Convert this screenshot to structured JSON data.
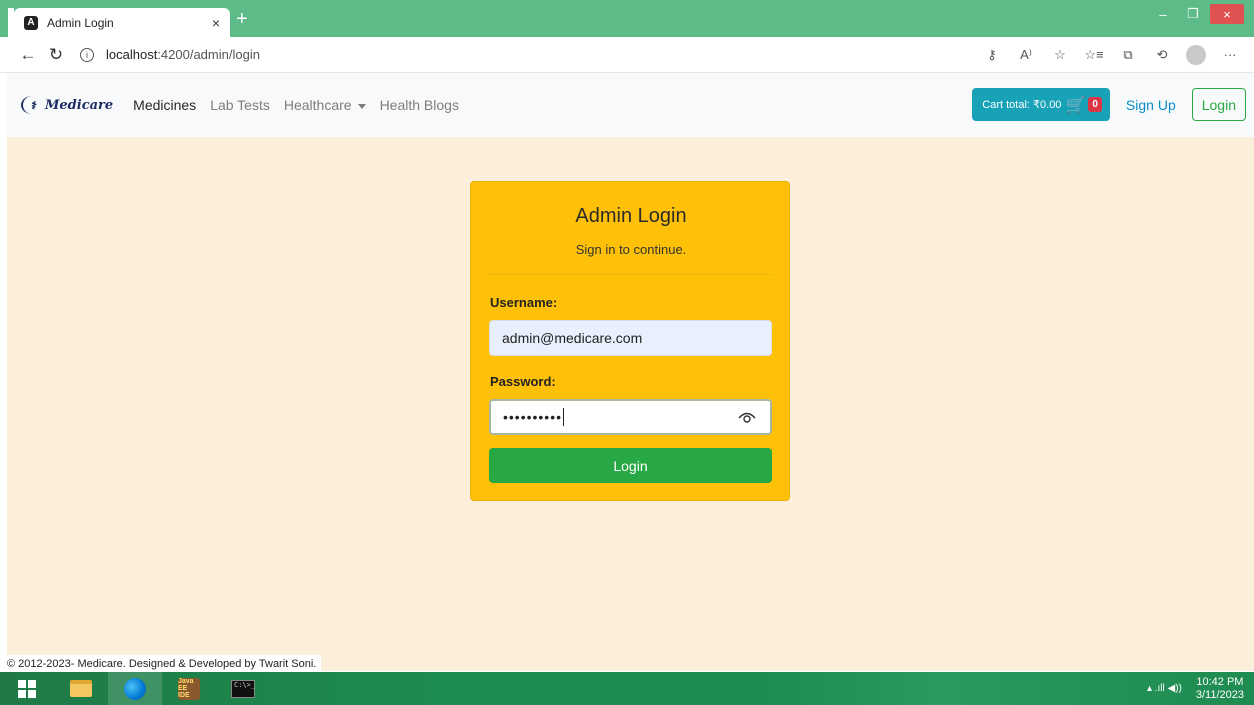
{
  "browser": {
    "tab_title": "Admin Login",
    "tab_close": "×",
    "new_tab": "+",
    "url_host": "localhost",
    "url_path": ":4200/admin/login",
    "window_controls": {
      "minimize": "–",
      "restore": "❐",
      "close": "×"
    },
    "nav": {
      "back": "←",
      "refresh": "↻",
      "info": "i"
    },
    "toolbar_icons": [
      "key-icon",
      "read-aloud-icon",
      "favorite-add-icon",
      "favorites-icon",
      "collections-icon",
      "history-icon",
      "profile-icon",
      "more-icon"
    ],
    "toolbar_glyphs": {
      "key": "⚷",
      "read_aloud": "A⁾",
      "favorite_add": "☆",
      "favorites": "☆≡",
      "collections": "⧉",
      "history": "⟲",
      "more": "···"
    }
  },
  "navbar": {
    "brand": "Medicare",
    "links": {
      "medicines": "Medicines",
      "lab_tests": "Lab Tests",
      "healthcare": "Healthcare",
      "health_blogs": "Health Blogs"
    },
    "cart_label": "Cart total: ₹0.00",
    "cart_icon": "🛒",
    "cart_count": "0",
    "signup": "Sign Up",
    "login": "Login"
  },
  "login_card": {
    "title": "Admin Login",
    "subtitle": "Sign in to continue.",
    "username_label": "Username:",
    "username_value": "admin@medicare.com",
    "password_label": "Password:",
    "password_masked": "••••••••••",
    "submit": "Login"
  },
  "footer": {
    "text": "© 2012-2023- Medicare. Designed & Developed by Twarit Soni."
  },
  "taskbar": {
    "ide_label": "Java EE IDE",
    "cmd_label": "C:\\>_",
    "tray_icons": "▴  .ıll  ◀))",
    "time": "10:42 PM",
    "date": "3/11/2023"
  },
  "colors": {
    "accent_green": "#28a745",
    "card_yellow": "#ffc107",
    "cart_teal": "#17a2b8",
    "badge_red": "#dc3545",
    "page_bg": "#fbefdc",
    "tab_strip": "#5dbb88"
  }
}
